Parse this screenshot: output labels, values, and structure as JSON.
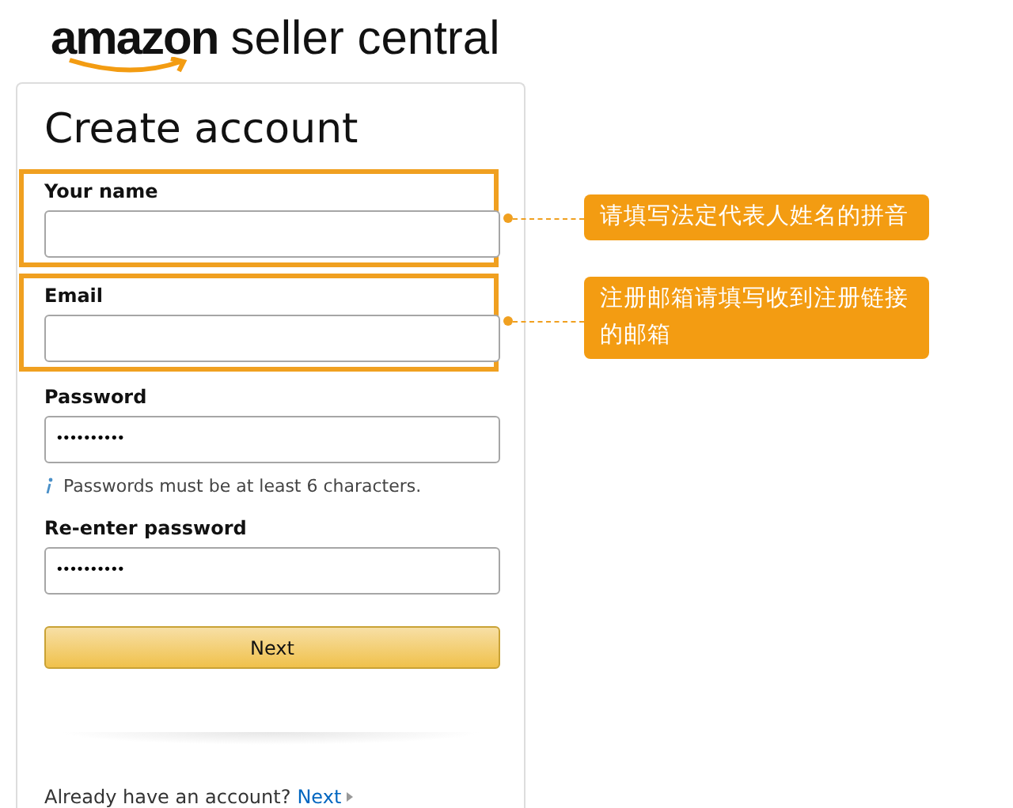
{
  "logo": {
    "brand": "amazon",
    "product": "seller central"
  },
  "form": {
    "title": "Create account",
    "fields": [
      {
        "label": "Your name",
        "kind": "text",
        "highlighted": true,
        "annotation": "请填写法定代表人姓名的拼音"
      },
      {
        "label": "Email",
        "kind": "text",
        "highlighted": true,
        "annotation": "注册邮箱请填写收到注册链接的邮箱"
      },
      {
        "label": "Password",
        "kind": "password",
        "value": "••••••••••",
        "highlighted": false,
        "hint": "Passwords must be at least 6 characters."
      },
      {
        "label": "Re-enter password",
        "kind": "password",
        "value": "••••••••••",
        "highlighted": false
      }
    ],
    "button": "Next",
    "footer": {
      "text": "Already have an account?",
      "link": "Next"
    }
  }
}
